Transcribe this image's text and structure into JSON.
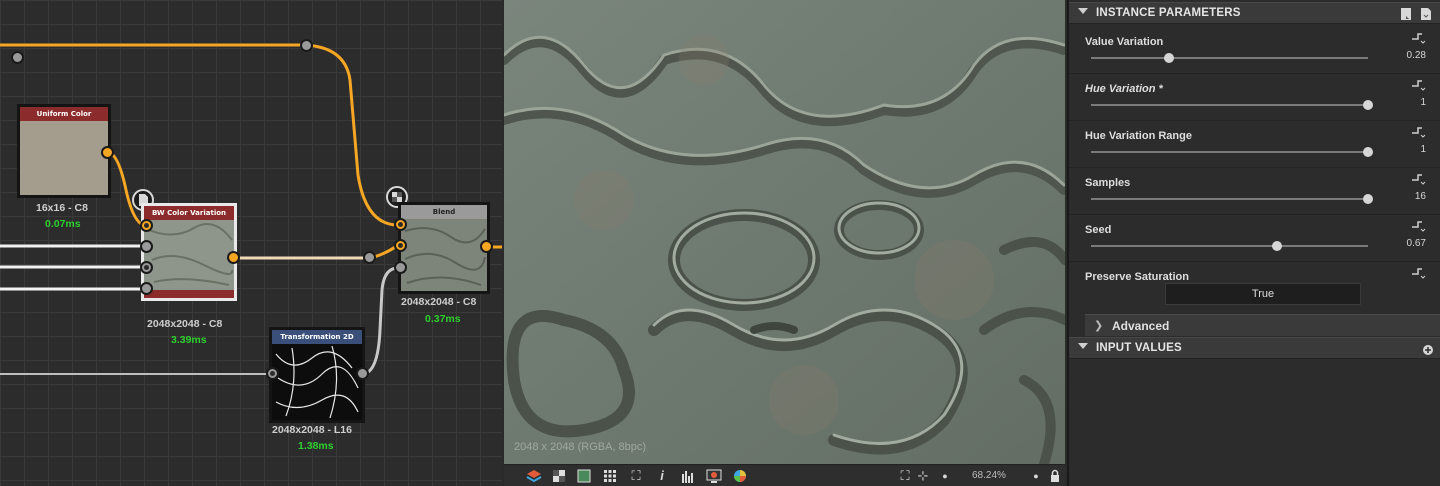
{
  "graph": {
    "nodes": {
      "uniform_color": {
        "title": "Uniform Color",
        "size": "16x16 - C8",
        "time": "0.07ms"
      },
      "bw_color_variation": {
        "title": "BW Color Variation",
        "size": "2048x2048 - C8",
        "time": "3.39ms"
      },
      "blend": {
        "title": "Blend",
        "size": "2048x2048 - C8",
        "time": "0.37ms"
      },
      "transformation_2d": {
        "title": "Transformation 2D",
        "size": "2048x2048 - L16",
        "time": "1.38ms"
      }
    },
    "colors": {
      "wire_orange": "#f5a623",
      "wire_white": "#f2f2f2",
      "time_green": "#2ed02e",
      "header_red": "#8b2b2b",
      "header_blue": "#3a4f7a",
      "header_gray": "#9a9a9a"
    }
  },
  "viewport": {
    "resolution": "2048 x 2048 (RGBA, 8bpc)",
    "zoom": "68.24%",
    "toolbar_icons": [
      "layers-icon",
      "checker-icon",
      "color-swatch-icon",
      "grid-icon",
      "tile-text-icon",
      "info-icon",
      "histogram-icon",
      "screen-icon",
      "color-wheel-icon",
      "fit-icon",
      "center-icon",
      "zoom-out-icon",
      "zoom-in-icon",
      "lock-icon"
    ]
  },
  "params": {
    "instance_header": "INSTANCE PARAMETERS",
    "rows": [
      {
        "label": "Value Variation",
        "value": "0.28",
        "fraction": 0.28
      },
      {
        "label": "Hue Variation *",
        "value": "1",
        "fraction": 1.0
      },
      {
        "label": "Hue Variation Range",
        "value": "1",
        "fraction": 1.0
      },
      {
        "label": "Samples",
        "value": "16",
        "fraction": 1.0
      },
      {
        "label": "Seed",
        "value": "0.67",
        "fraction": 0.67
      }
    ],
    "preserve_saturation": {
      "label": "Preserve Saturation",
      "value": "True"
    },
    "advanced_label": "Advanced",
    "input_values_header": "INPUT VALUES"
  }
}
